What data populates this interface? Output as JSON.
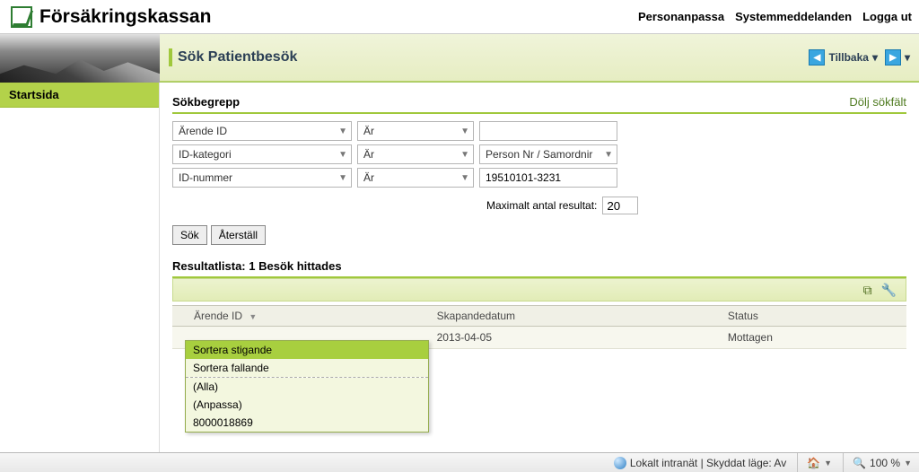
{
  "brand": "Försäkringskassan",
  "toplinks": {
    "personalize": "Personanpassa",
    "sysmsg": "Systemmeddelanden",
    "logout": "Logga ut"
  },
  "title": "Sök Patientbesök",
  "back_label": "Tillbaka",
  "sidebar": {
    "home": "Startsida"
  },
  "search": {
    "heading": "Sökbegrepp",
    "toggle": "Dölj sökfält",
    "rows": [
      {
        "field": "Ärende ID",
        "op": "Är",
        "value": ""
      },
      {
        "field": "ID-kategori",
        "op": "Är",
        "value": "Person Nr / Samordnir"
      },
      {
        "field": "ID-nummer",
        "op": "Är",
        "value": "19510101-3231"
      }
    ],
    "max_label": "Maximalt antal resultat:",
    "max_value": "20",
    "search_btn": "Sök",
    "reset_btn": "Återställ"
  },
  "results": {
    "heading": "Resultatlista: 1 Besök hittades",
    "columns": {
      "c1": "Ärende ID",
      "c2": "Skapandedatum",
      "c3": "Status"
    },
    "rows": [
      {
        "arende": "",
        "datum": "2013-04-05",
        "status": "Mottagen"
      }
    ]
  },
  "filter_menu": {
    "sort_asc": "Sortera stigande",
    "sort_desc": "Sortera fallande",
    "all": "(Alla)",
    "custom": "(Anpassa)",
    "val1": "8000018869"
  },
  "statusbar": {
    "zone": "Lokalt intranät | Skyddat läge: Av",
    "zoom": "100 %"
  }
}
